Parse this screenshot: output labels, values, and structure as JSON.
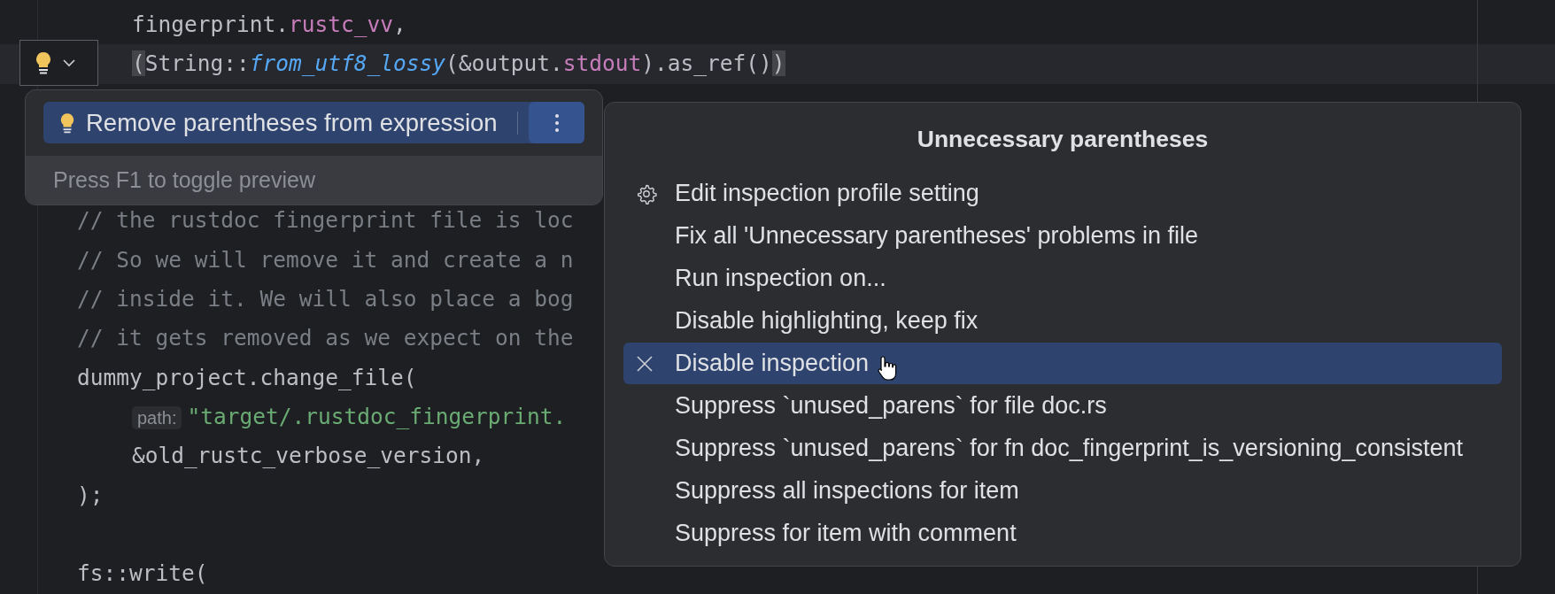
{
  "editor": {
    "lines": [
      {
        "current": false,
        "indented": true,
        "segments": [
          {
            "kind": "plain",
            "text": "fingerprint."
          },
          {
            "kind": "field",
            "text": "rustc_vv"
          },
          {
            "kind": "plain",
            "text": ","
          }
        ]
      },
      {
        "current": true,
        "indented": true,
        "segments": [
          {
            "kind": "brace-match",
            "text": "("
          },
          {
            "kind": "plain",
            "text": "String::"
          },
          {
            "kind": "function",
            "text": "from_utf8_lossy"
          },
          {
            "kind": "plain",
            "text": "(&output."
          },
          {
            "kind": "field",
            "text": "stdout"
          },
          {
            "kind": "plain",
            "text": ").as_ref()"
          },
          {
            "kind": "brace-match",
            "text": ")"
          }
        ]
      },
      {
        "current": false
      },
      {
        "current": false
      },
      {
        "current": false
      },
      {
        "current": false,
        "indented": false,
        "segments": [
          {
            "kind": "comment",
            "text": "// the rustdoc fingerprint file is loc"
          }
        ]
      },
      {
        "current": false,
        "indented": false,
        "segments": [
          {
            "kind": "comment",
            "text": "// So we will remove it and create a n"
          }
        ]
      },
      {
        "current": false,
        "indented": false,
        "segments": [
          {
            "kind": "comment",
            "text": "// inside it. We will also place a bog"
          }
        ]
      },
      {
        "current": false,
        "indented": false,
        "segments": [
          {
            "kind": "comment",
            "text": "// it gets removed as we expect on the"
          }
        ]
      },
      {
        "current": false,
        "indented": false,
        "segments": [
          {
            "kind": "plain",
            "text": "dummy_project.change_file("
          }
        ]
      },
      {
        "current": false,
        "indented": true,
        "segments": [
          {
            "kind": "hint",
            "text": "path:"
          },
          {
            "kind": "string",
            "text": "\"target/.rustdoc_fingerprint."
          }
        ]
      },
      {
        "current": false,
        "indented": true,
        "segments": [
          {
            "kind": "plain",
            "text": "&old_rustc_verbose_version,"
          }
        ]
      },
      {
        "current": false,
        "indented": false,
        "segments": [
          {
            "kind": "plain",
            "text": ");"
          }
        ]
      },
      {
        "current": false
      },
      {
        "current": false,
        "indented": false,
        "segments": [
          {
            "kind": "plain",
            "text": "fs::write("
          }
        ]
      }
    ]
  },
  "intention_popup": {
    "actions": [
      {
        "label": "Remove parentheses from expression",
        "selected": true
      }
    ],
    "footer": "Press F1 to toggle preview"
  },
  "options_popup": {
    "title": "Unnecessary parentheses",
    "items": [
      {
        "kind": "settings",
        "label": "Edit inspection profile setting",
        "selected": false
      },
      {
        "kind": "action",
        "label": "Fix all 'Unnecessary parentheses' problems in file",
        "selected": false
      },
      {
        "kind": "action",
        "label": "Run inspection on...",
        "selected": false
      },
      {
        "kind": "action",
        "label": "Disable highlighting, keep fix",
        "selected": false
      },
      {
        "kind": "disable",
        "label": "Disable inspection",
        "selected": true
      },
      {
        "kind": "action",
        "label": "Suppress `unused_parens` for file doc.rs",
        "selected": false
      },
      {
        "kind": "action",
        "label": "Suppress `unused_parens` for fn doc_fingerprint_is_versioning_consistent",
        "selected": false
      },
      {
        "kind": "action",
        "label": "Suppress all inspections for item",
        "selected": false
      },
      {
        "kind": "action",
        "label": "Suppress for item with comment",
        "selected": false
      }
    ]
  }
}
